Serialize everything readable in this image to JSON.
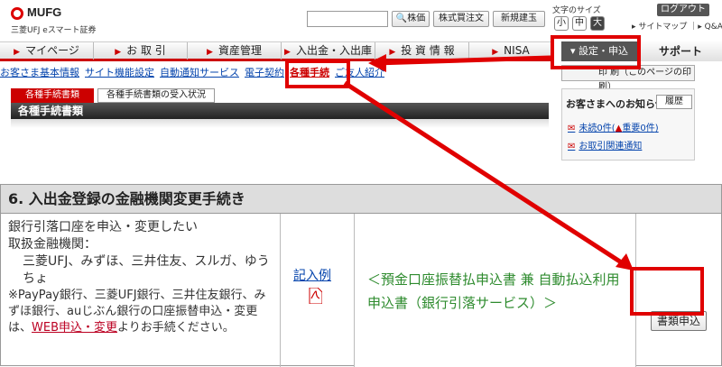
{
  "header": {
    "brand": "MUFG",
    "brand_sub": "三菱UFJ eスマート証券",
    "search_buttons": [
      "株価",
      "株式買注文",
      "新規建玉"
    ],
    "fontsize_label": "文字のサイズ",
    "fontsize_options": [
      "小",
      "中",
      "大"
    ],
    "logout": "ログアウト",
    "sitemap": "▸ サイトマップ ｜▸ Q&A"
  },
  "nav": {
    "items": [
      "マイページ",
      "お 取 引",
      "資産管理",
      "入出金・入出庫",
      "投 資 情 報",
      "NISA"
    ],
    "settings": "▾ 設定・申込",
    "support": "サポート"
  },
  "subnav": [
    "お客さま基本情報",
    "サイト機能設定",
    "自動通知サービス",
    "電子契約",
    "各種手続",
    "ご友人紹介"
  ],
  "print_label": "印 刷（このページの印刷）",
  "tabs": {
    "active": "各種手続書類",
    "other": "各種手続書類の受入状況"
  },
  "section_title": "各種手続書類",
  "notice": {
    "title": "お客さまへのお知らせ",
    "history": "履歴",
    "unread_prefix": "未読0件(",
    "unread_important": "重要0件",
    "unread_suffix": ")",
    "trade_link": "お取引関連通知"
  },
  "table": {
    "header": "6. 入出金登録の金融機関変更手続き",
    "desc_line1": "銀行引落口座を申込・変更したい",
    "desc_line2": "取扱金融機関：",
    "desc_line3": "三菱UFJ、みずほ、三井住友、スルガ、ゆうちょ",
    "desc_note_pre": "※PayPay銀行、三菱UFJ銀行、三井住友銀行、みずほ銀行、auじぶん銀行の口座振替申込・変更は、",
    "desc_note_link": "WEB申込・変更",
    "desc_note_post": "よりお手続ください。",
    "sample_link": "記入例",
    "form_name": "＜預金口座振替払申込書 兼 自動払込利用申込書（銀行引落サービス）＞",
    "apply_button": "書類申込"
  }
}
